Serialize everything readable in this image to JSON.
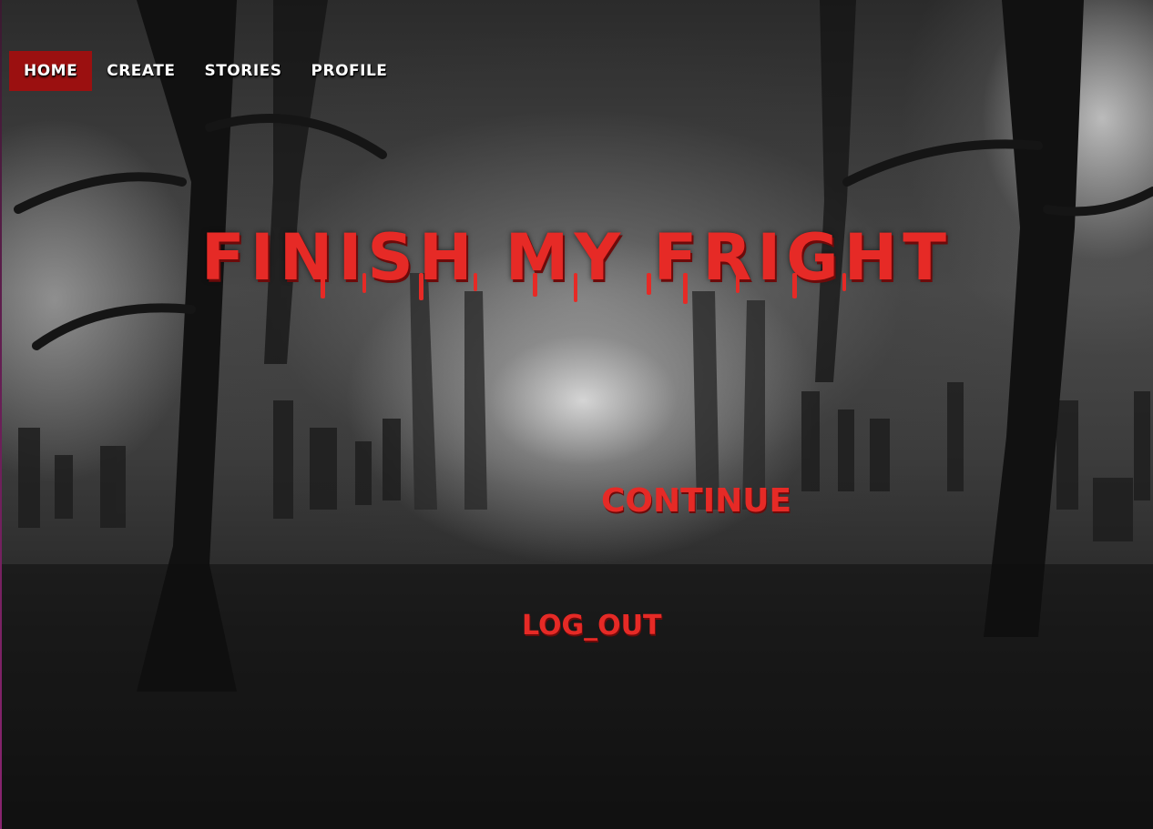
{
  "nav": {
    "items": [
      {
        "label": "HOME",
        "active": true
      },
      {
        "label": "CREATE",
        "active": false
      },
      {
        "label": "STORIES",
        "active": false
      },
      {
        "label": "PROFILE",
        "active": false
      }
    ]
  },
  "hero": {
    "title": "FINISH MY FRIGHT"
  },
  "actions": {
    "continue_label": "CONTINUE",
    "logout_label": "LOG_OUT"
  },
  "colors": {
    "accent": "#e62a26",
    "nav_active": "#9b1010",
    "nav_text": "#ffffff"
  }
}
